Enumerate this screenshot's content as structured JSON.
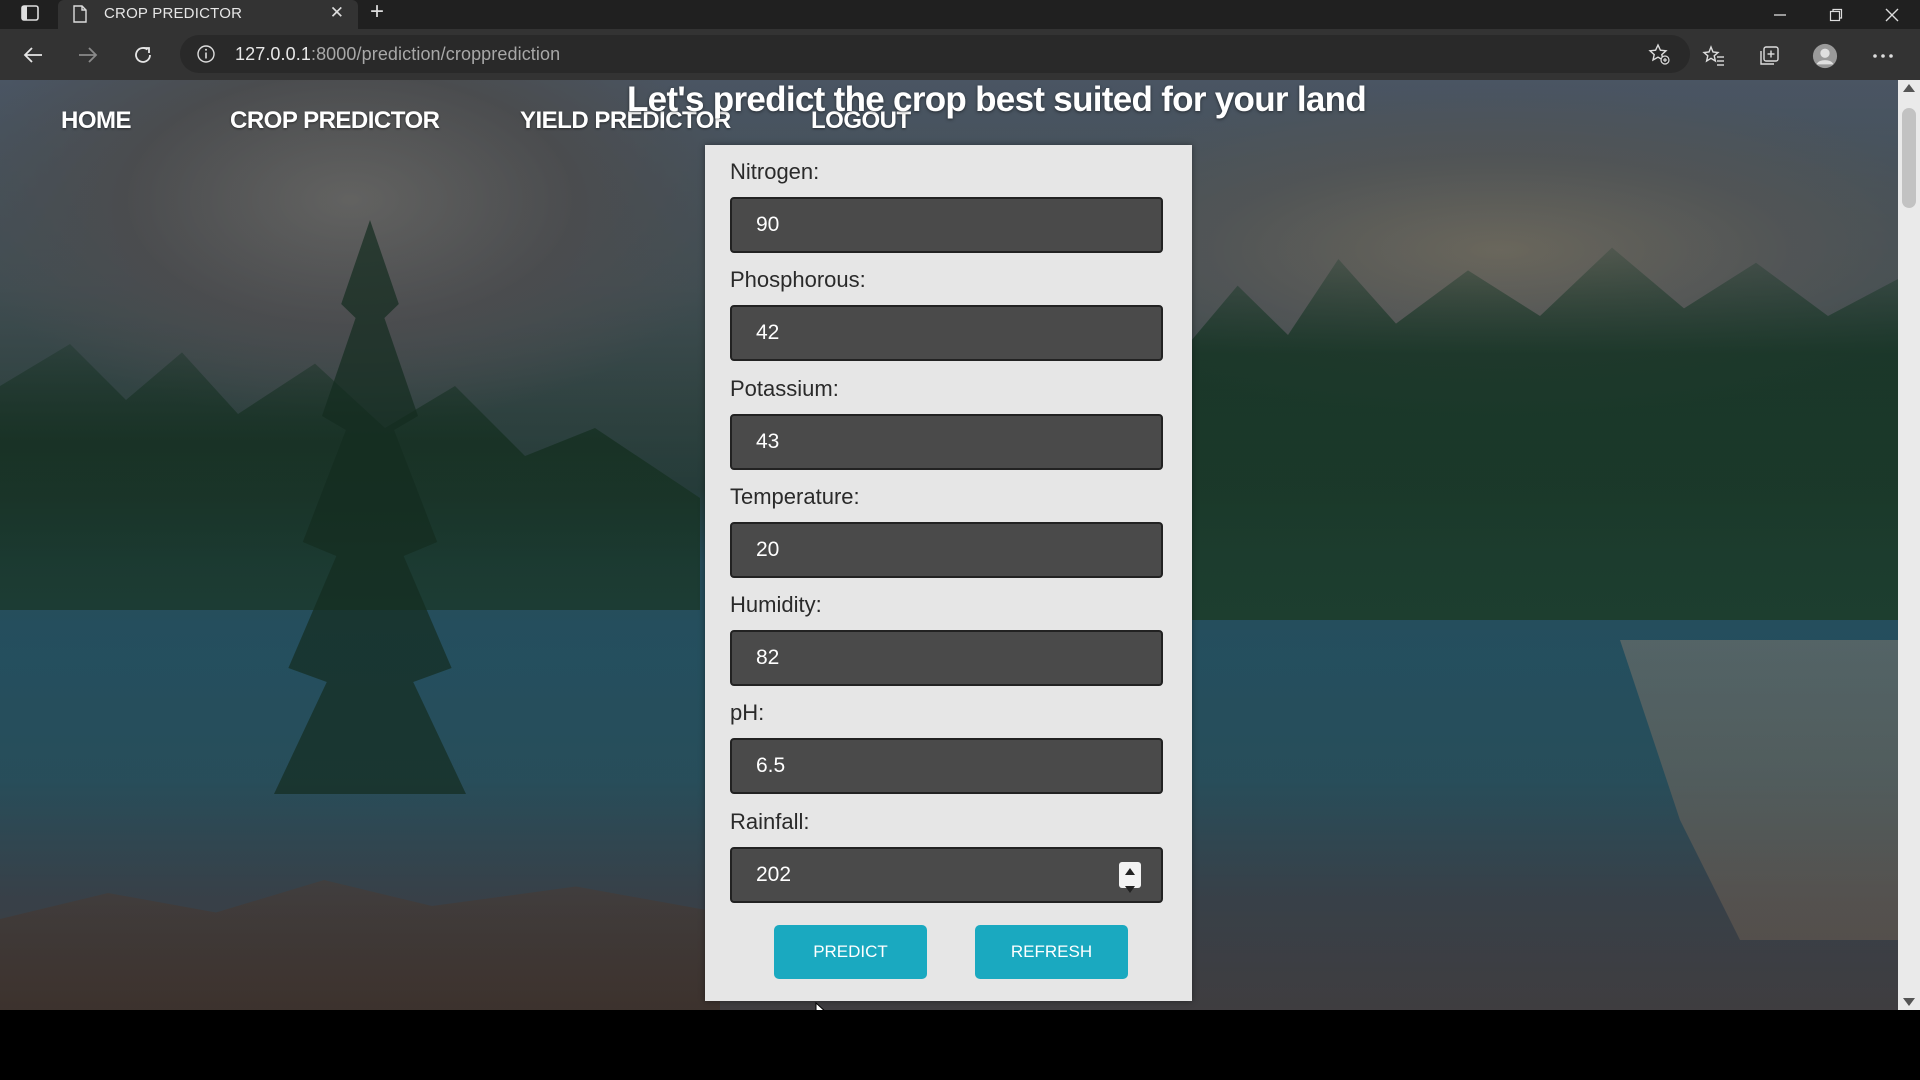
{
  "browser": {
    "tab_title": "CROP PREDICTOR",
    "url_host": "127.0.0.1",
    "url_rest": ":8000/prediction/cropprediction"
  },
  "nav": {
    "items": [
      "HOME",
      "CROP PREDICTOR",
      "YIELD PREDICTOR",
      "LOGOUT"
    ]
  },
  "page": {
    "heading": "Let's predict the crop best suited for your land"
  },
  "form": {
    "fields": [
      {
        "label": "Nitrogen:",
        "value": "90"
      },
      {
        "label": "Phosphorous:",
        "value": "42"
      },
      {
        "label": "Potassium:",
        "value": "43"
      },
      {
        "label": "Temperature:",
        "value": "20"
      },
      {
        "label": "Humidity:",
        "value": "82"
      },
      {
        "label": "pH:",
        "value": "6.5"
      },
      {
        "label": "Rainfall:",
        "value": "202"
      }
    ],
    "predict_label": "PREDICT",
    "refresh_label": "REFRESH"
  },
  "colors": {
    "button_accent": "#1aa9c0",
    "input_bg": "#4a4a4a",
    "card_bg": "#e6e6e6"
  }
}
